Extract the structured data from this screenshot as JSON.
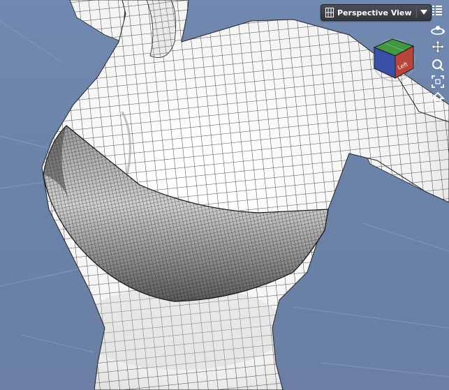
{
  "viewport": {
    "view_name": "Perspective View",
    "view_cube_face_label": "Left",
    "colors": {
      "background": "#6f85aa",
      "mesh_fill": "#ffffff",
      "wire": "#1a1a1a",
      "garment_fill": "#5a5a5a",
      "cube_green": "#3f9a3f",
      "cube_blue": "#3a4fa8",
      "cube_red": "#b8443c"
    }
  },
  "nav_controls": [
    {
      "name": "orbit",
      "icon": "orbit-icon"
    },
    {
      "name": "pan",
      "icon": "pan-icon"
    },
    {
      "name": "zoom",
      "icon": "zoom-icon"
    },
    {
      "name": "frame",
      "icon": "frame-icon"
    },
    {
      "name": "home",
      "icon": "home-icon"
    }
  ]
}
